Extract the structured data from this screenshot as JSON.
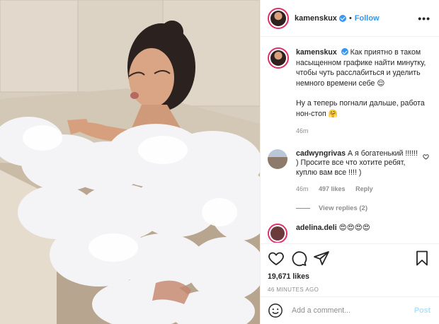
{
  "header": {
    "username": "kamenskux",
    "dot": "•",
    "follow_label": "Follow",
    "more_label": "•••"
  },
  "caption": {
    "username": "kamenskux",
    "text_line1": "Как приятно в таком насыщенном графике найти минутку, чтобы чуть расслабиться и уделить немного времени себе 😌",
    "text_line2": "Ну а теперь погнали дальше, работа нон-стоп 🤗",
    "time": "46m"
  },
  "comments": [
    {
      "username": "cadwyngrivas",
      "text": "А я богатенький !!!!!! ) Просите все что хотите ребят, куплю вам все !!!! )",
      "time": "46m",
      "likes": "497 likes",
      "reply_label": "Reply",
      "view_replies": "View replies (2)"
    },
    {
      "username": "adelina.deli",
      "text": "😍😍😍😍"
    }
  ],
  "stats": {
    "likes": "19,671 likes",
    "ago": "46 MINUTES AGO"
  },
  "composer": {
    "placeholder": "Add a comment...",
    "post_label": "Post"
  },
  "icons": {
    "like": "heart-icon",
    "comment": "comment-icon",
    "share": "paper-plane-icon",
    "save": "bookmark-icon",
    "emoji": "smiley-icon",
    "verified": "verified-badge-icon"
  },
  "colors": {
    "accent": "#3897f0",
    "post_disabled": "#b2dffc",
    "muted": "#8e8e8e",
    "text": "#262626"
  }
}
